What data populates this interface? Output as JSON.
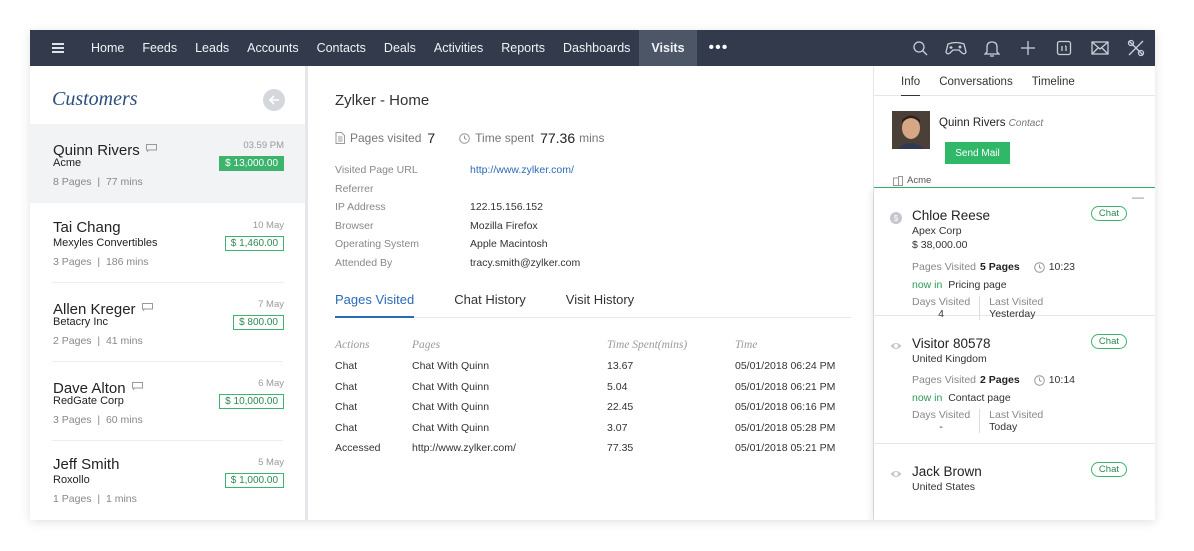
{
  "nav": {
    "items": [
      "Home",
      "Feeds",
      "Leads",
      "Accounts",
      "Contacts",
      "Deals",
      "Activities",
      "Reports",
      "Dashboards",
      "Visits"
    ],
    "active": "Visits",
    "more": "•••",
    "icons": [
      "search-icon",
      "gamepad-icon",
      "bell-icon",
      "plus-icon",
      "calendar-icon",
      "mail-icon",
      "tools-icon"
    ]
  },
  "left": {
    "title": "Customers",
    "customers": [
      {
        "name": "Quinn Rivers",
        "company": "Acme",
        "pages": "8 Pages",
        "mins": "77 mins",
        "time": "03.59 PM",
        "amount": "$ 13,000.00",
        "chat": true
      },
      {
        "name": "Tai Chang",
        "company": "Mexyles Convertibles",
        "pages": "3 Pages",
        "mins": "186 mins",
        "time": "10 May",
        "amount": "$ 1,460.00",
        "chat": false
      },
      {
        "name": "Allen Kreger",
        "company": "Betacry Inc",
        "pages": "2 Pages",
        "mins": "41 mins",
        "time": "7 May",
        "amount": "$ 800.00",
        "chat": true
      },
      {
        "name": "Dave Alton",
        "company": "RedGate Corp",
        "pages": "3 Pages",
        "mins": "60 mins",
        "time": "6 May",
        "amount": "$ 10,000.00",
        "chat": true
      },
      {
        "name": "Jeff Smith",
        "company": "Roxollo",
        "pages": "1 Pages",
        "mins": "1 mins",
        "time": "5 May",
        "amount": "$ 1,000.00",
        "chat": false
      }
    ]
  },
  "main": {
    "title": "Zylker - Home",
    "pages_visited_label": "Pages visited",
    "pages_visited": "7",
    "time_spent_label": "Time spent",
    "time_spent": "77.36",
    "time_unit": "mins",
    "details": [
      {
        "key": "Visited Page URL",
        "value": "http://www.zylker.com/",
        "link": true
      },
      {
        "key": "Referrer",
        "value": "",
        "link": false
      },
      {
        "key": "IP Address",
        "value": "122.15.156.152",
        "link": false
      },
      {
        "key": "Browser",
        "value": "Mozilla Firefox",
        "link": false
      },
      {
        "key": "Operating System",
        "value": "Apple Macintosh",
        "link": false
      },
      {
        "key": "Attended By",
        "value": "tracy.smith@zylker.com",
        "link": false
      }
    ],
    "tabs": [
      "Pages Visited",
      "Chat History",
      "Visit History"
    ],
    "table": {
      "headers": [
        "Actions",
        "Pages",
        "Time Spent(mins)",
        "Time"
      ],
      "rows": [
        [
          "Chat",
          "Chat With Quinn",
          "13.67",
          "05/01/2018 06:24 PM"
        ],
        [
          "Chat",
          "Chat With Quinn",
          "5.04",
          "05/01/2018 06:21 PM"
        ],
        [
          "Chat",
          "Chat With Quinn",
          "22.45",
          "05/01/2018 06:16 PM"
        ],
        [
          "Chat",
          "Chat With Quinn",
          "3.07",
          "05/01/2018 05:28 PM"
        ],
        [
          "Accessed",
          "http://www.zylker.com/",
          "77.35",
          "05/01/2018 05:21 PM"
        ]
      ]
    }
  },
  "right": {
    "tabs": [
      "Info",
      "Conversations",
      "Timeline"
    ],
    "contact": {
      "name": "Quinn Rivers",
      "role": "Contact",
      "send_mail": "Send Mail",
      "company": "Acme"
    },
    "collapse": "—",
    "visitors": [
      {
        "name": "Chloe Reese",
        "sub": "Apex Corp",
        "amount": "$ 38,000.00",
        "badge": "Chat",
        "pages_label": "Pages Visited",
        "pages": "5 Pages",
        "clock": "10:23",
        "now_in": "now in",
        "page": "Pricing page",
        "days_label": "Days Visited",
        "days": "4",
        "last_label": "Last Visited",
        "last": "Yesterday",
        "icon": "dollar-icon"
      },
      {
        "name": "Visitor 80578",
        "sub": "United Kingdom",
        "amount": "",
        "badge": "Chat",
        "pages_label": "Pages Visited",
        "pages": "2 Pages",
        "clock": "10:14",
        "now_in": "now in",
        "page": "Contact page",
        "days_label": "Days Visited",
        "days": "-",
        "last_label": "Last Visited",
        "last": "Today",
        "icon": "eye-icon"
      },
      {
        "name": "Jack Brown",
        "sub": "United States",
        "amount": "",
        "badge": "Chat",
        "icon": "eye-icon"
      }
    ]
  }
}
